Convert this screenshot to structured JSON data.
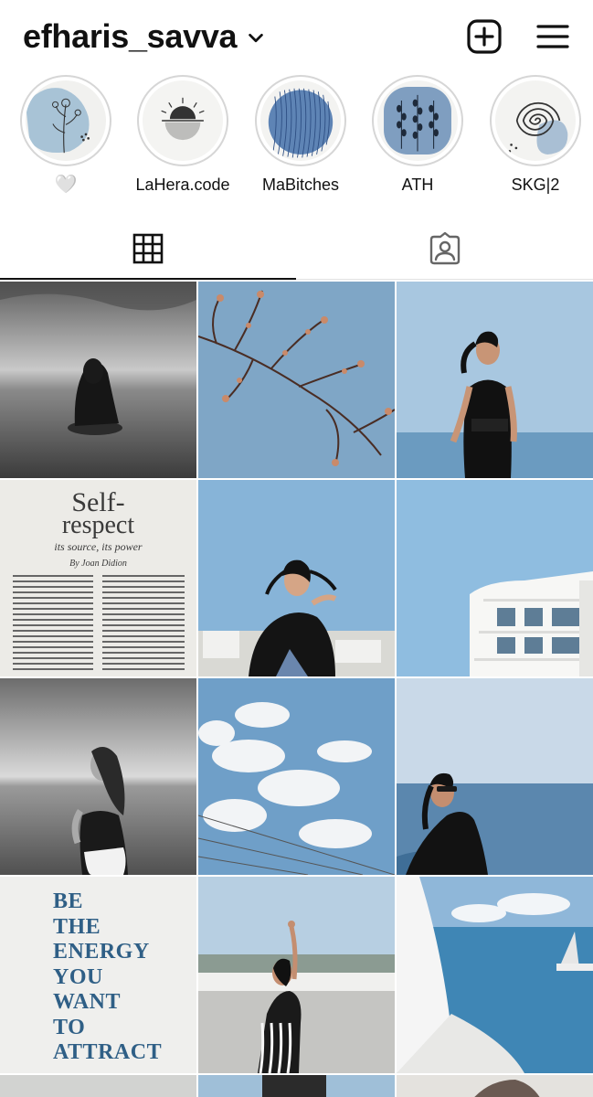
{
  "header": {
    "username": "efharis_savva"
  },
  "highlights": [
    {
      "label": "🤍"
    },
    {
      "label": "LaHera.code"
    },
    {
      "label": "MaBitches"
    },
    {
      "label": "ATH"
    },
    {
      "label": "SKG|2"
    }
  ],
  "posts": {
    "quote_lines": [
      "BE",
      "THE",
      "ENERGY",
      "YOU",
      "WANT",
      "TO",
      "ATTRACT"
    ],
    "magazine": {
      "title_line1": "Self-",
      "title_line2": "respect",
      "subtitle": "its source, its power",
      "byline": "By Joan Didion"
    }
  },
  "colors": {
    "sky": "#a9c6dd",
    "accent_blue": "#2f5f86",
    "text": "#111111",
    "divider": "#e2e2e2"
  }
}
